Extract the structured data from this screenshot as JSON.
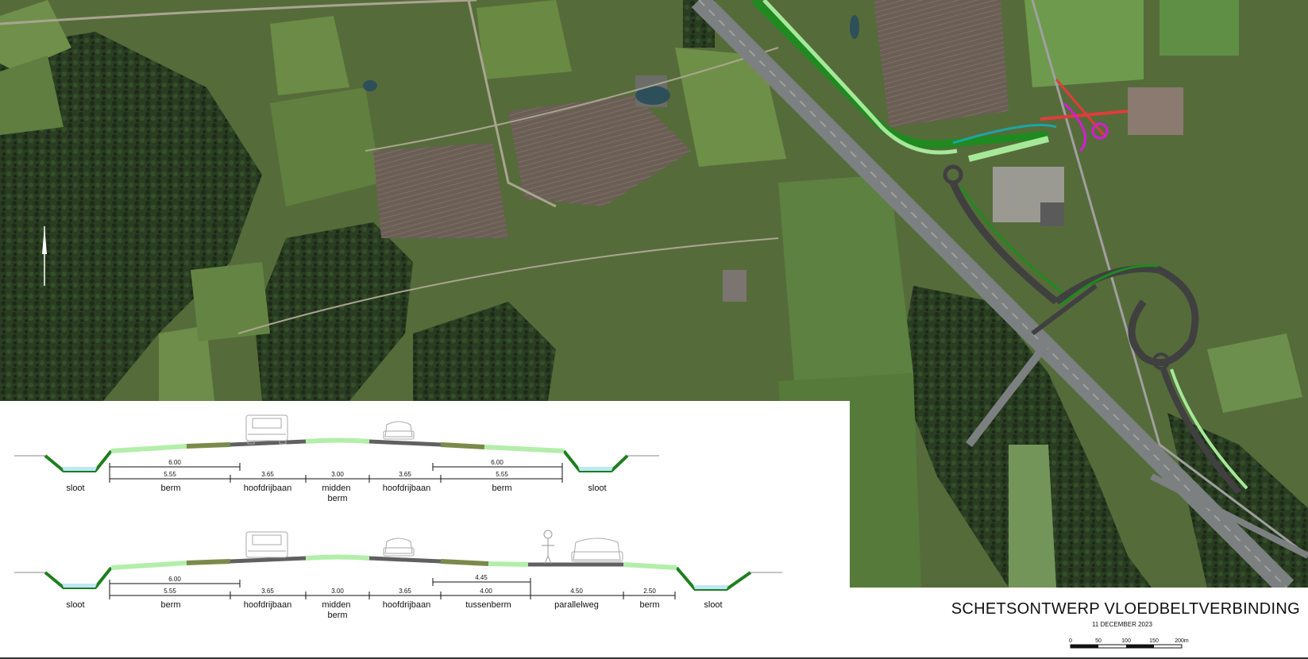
{
  "title": "SCHETSONTWERP VLOEDBELTVERBINDING",
  "date": "11 DECEMBER 2023",
  "scale_bar": {
    "ticks": [
      "0",
      "50",
      "100",
      "150",
      "200m"
    ]
  },
  "map": {
    "colors": {
      "aerial_field": "#4e6a32",
      "forest": "#243a1e",
      "highway": "#7c8080",
      "design_green": "#1f8a1f",
      "design_light": "#a6e89a",
      "design_teal": "#1aa6a6",
      "design_red": "#e03c3c",
      "design_magenta": "#d81ad8",
      "design_road": "#404040"
    },
    "north_arrow": "north-arrow-icon"
  },
  "cross_sections": [
    {
      "labels": [
        "sloot",
        "berm",
        "hoofdrijbaan",
        "midden\nberm",
        "hoofdrijbaan",
        "berm",
        "sloot"
      ],
      "dims_top": [
        "6.00",
        "6.00"
      ],
      "dims_bottom": [
        "5.55",
        "3.65",
        "3.00",
        "3.65",
        "5.55"
      ]
    },
    {
      "labels": [
        "sloot",
        "berm",
        "hoofdrijbaan",
        "midden\nberm",
        "hoofdrijbaan",
        "tussenberm",
        "parallelweg",
        "berm",
        "sloot"
      ],
      "dims_top": [
        "6.00",
        "4.45"
      ],
      "dims_bottom": [
        "5.55",
        "3.65",
        "3.00",
        "3.65",
        "4.00",
        "4.50",
        "2.50"
      ]
    }
  ],
  "section_colors": {
    "berm": "#b3eeaa",
    "carriageway": "#606060",
    "verge": "#7a8a4a",
    "ditch_line": "#1d7f1d",
    "water": "#bfe7f5"
  }
}
